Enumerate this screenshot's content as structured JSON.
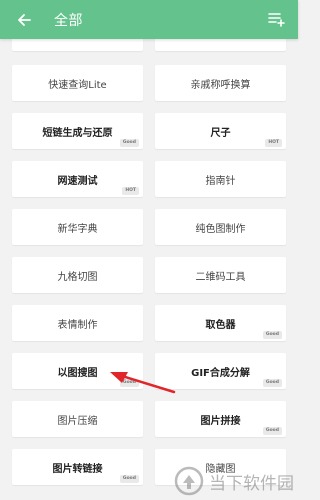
{
  "header": {
    "title": "全部"
  },
  "tiles": [
    {
      "label": "快速查询Lite",
      "badge": "",
      "bold": false
    },
    {
      "label": "亲戚称呼换算",
      "badge": "",
      "bold": false
    },
    {
      "label": "短链生成与还原",
      "badge": "Good",
      "bold": true
    },
    {
      "label": "尺子",
      "badge": "HOT",
      "bold": true
    },
    {
      "label": "网速测试",
      "badge": "HOT",
      "bold": true
    },
    {
      "label": "指南针",
      "badge": "",
      "bold": false
    },
    {
      "label": "新华字典",
      "badge": "",
      "bold": false
    },
    {
      "label": "纯色图制作",
      "badge": "",
      "bold": false
    },
    {
      "label": "九格切图",
      "badge": "",
      "bold": false
    },
    {
      "label": "二维码工具",
      "badge": "",
      "bold": false
    },
    {
      "label": "表情制作",
      "badge": "",
      "bold": false
    },
    {
      "label": "取色器",
      "badge": "Good",
      "bold": true
    },
    {
      "label": "以图搜图",
      "badge": "Good",
      "bold": true
    },
    {
      "label": "GIF合成分解",
      "badge": "Good",
      "bold": true
    },
    {
      "label": "图片压缩",
      "badge": "",
      "bold": false
    },
    {
      "label": "图片拼接",
      "badge": "Good",
      "bold": true
    },
    {
      "label": "图片转链接",
      "badge": "Good",
      "bold": true
    },
    {
      "label": "隐藏图",
      "badge": "",
      "bold": false
    }
  ],
  "watermark": {
    "text": "当下软件园"
  },
  "colors": {
    "appbar": "#64c38c",
    "arrow": "#e0262b"
  },
  "icons": {
    "back": "arrow-left-icon",
    "menu": "playlist-add-icon"
  }
}
